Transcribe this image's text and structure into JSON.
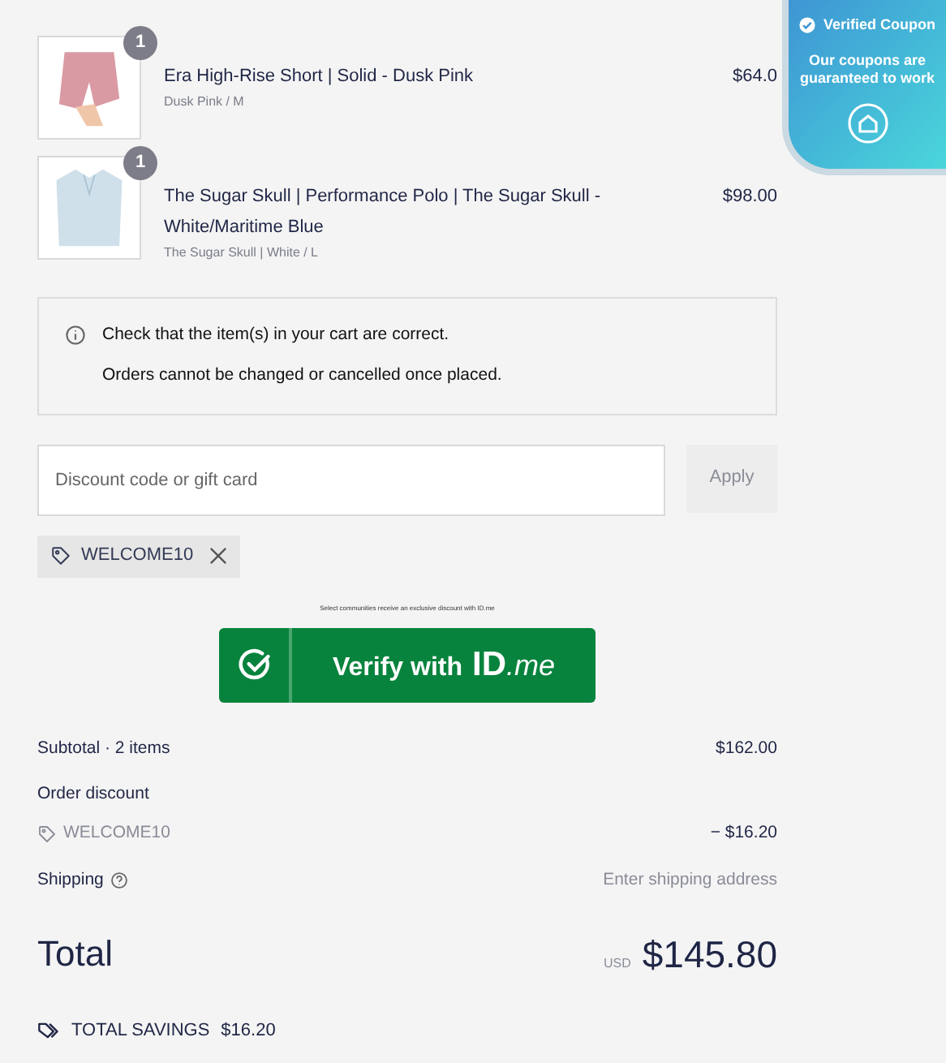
{
  "cart_items": [
    {
      "kind": "shorts",
      "quantity": "1",
      "name": "Era High-Rise Short | Solid - Dusk Pink",
      "variant": "Dusk Pink / M",
      "price": "$64.0"
    },
    {
      "kind": "polo",
      "quantity": "1",
      "name": "The Sugar Skull | Performance Polo | The Sugar Skull - White/Maritime Blue",
      "variant": "The Sugar Skull | White / L",
      "price": "$98.00"
    }
  ],
  "notice": {
    "lines": [
      "Check that the item(s) in your cart are correct.",
      "Orders cannot be changed or cancelled once placed."
    ]
  },
  "discount": {
    "placeholder": "Discount code or gift card",
    "apply_label": "Apply",
    "applied_codes": [
      "WELCOME10"
    ]
  },
  "idme": {
    "caption": "Select communities receive an exclusive discount with ID.me",
    "button_label": "Verify with",
    "brand_id": "ID",
    "brand_me": ".me"
  },
  "summary": {
    "subtotal_label": "Subtotal · 2 items",
    "subtotal_value": "$162.00",
    "discount_label": "Order discount",
    "discount_code": "WELCOME10",
    "discount_value": "− $16.20",
    "shipping_label": "Shipping",
    "shipping_value": "Enter shipping address",
    "total_label": "Total",
    "currency": "USD",
    "total_value": "$145.80",
    "savings_label": "TOTAL SAVINGS",
    "savings_value": "$16.20"
  },
  "coupon_badge": {
    "title": "Verified Coupon",
    "text": "Our coupons are guaranteed to work"
  }
}
